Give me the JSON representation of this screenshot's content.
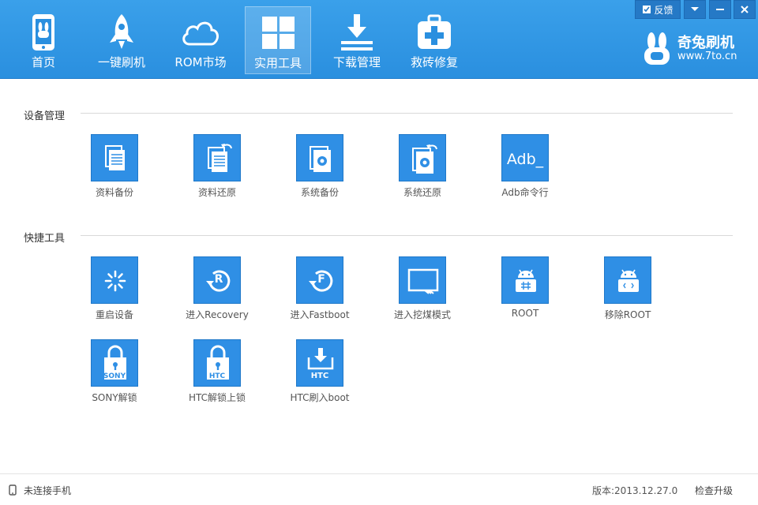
{
  "nav": {
    "items": [
      {
        "label": "首页",
        "icon": "phone-rabbit-icon"
      },
      {
        "label": "一键刷机",
        "icon": "rocket-icon"
      },
      {
        "label": "ROM市场",
        "icon": "cloud-icon"
      },
      {
        "label": "实用工具",
        "icon": "grid-icon",
        "active": true
      },
      {
        "label": "下载管理",
        "icon": "download-icon"
      },
      {
        "label": "救砖修复",
        "icon": "first-aid-kit-icon"
      }
    ]
  },
  "window": {
    "feedback_label": "反馈"
  },
  "brand": {
    "name": "奇兔刷机",
    "url": "www.7to.cn"
  },
  "sections": {
    "device": {
      "title": "设备管理",
      "tools": [
        {
          "label": "资料备份",
          "icon": "data-backup-icon"
        },
        {
          "label": "资料还原",
          "icon": "data-restore-icon"
        },
        {
          "label": "系统备份",
          "icon": "system-backup-icon"
        },
        {
          "label": "系统还原",
          "icon": "system-restore-icon"
        },
        {
          "label": "Adb命令行",
          "icon": "adb-icon",
          "tile_text": "Adb_"
        }
      ]
    },
    "quick": {
      "title": "快捷工具",
      "tools": [
        {
          "label": "重启设备",
          "icon": "reboot-icon"
        },
        {
          "label": "进入Recovery",
          "icon": "recovery-icon",
          "tile_text": "R"
        },
        {
          "label": "进入Fastboot",
          "icon": "fastboot-icon",
          "tile_text": "F"
        },
        {
          "label": "进入挖煤模式",
          "icon": "download-mode-icon"
        },
        {
          "label": "ROOT",
          "icon": "root-android-icon"
        },
        {
          "label": "移除ROOT",
          "icon": "unroot-android-icon"
        },
        {
          "label": "SONY解锁",
          "icon": "sony-unlock-icon",
          "tile_text": "SONY"
        },
        {
          "label": "HTC解锁上锁",
          "icon": "htc-lock-icon",
          "tile_text": "HTC"
        },
        {
          "label": "HTC刷入boot",
          "icon": "htc-flash-boot-icon",
          "tile_text": "HTC"
        }
      ]
    }
  },
  "status": {
    "connection": "未连接手机",
    "version": "版本:2013.12.27.0",
    "upgrade_label": "检查升级"
  },
  "colors": {
    "header": "#2a8fdf",
    "tile": "#2f8fe5"
  }
}
